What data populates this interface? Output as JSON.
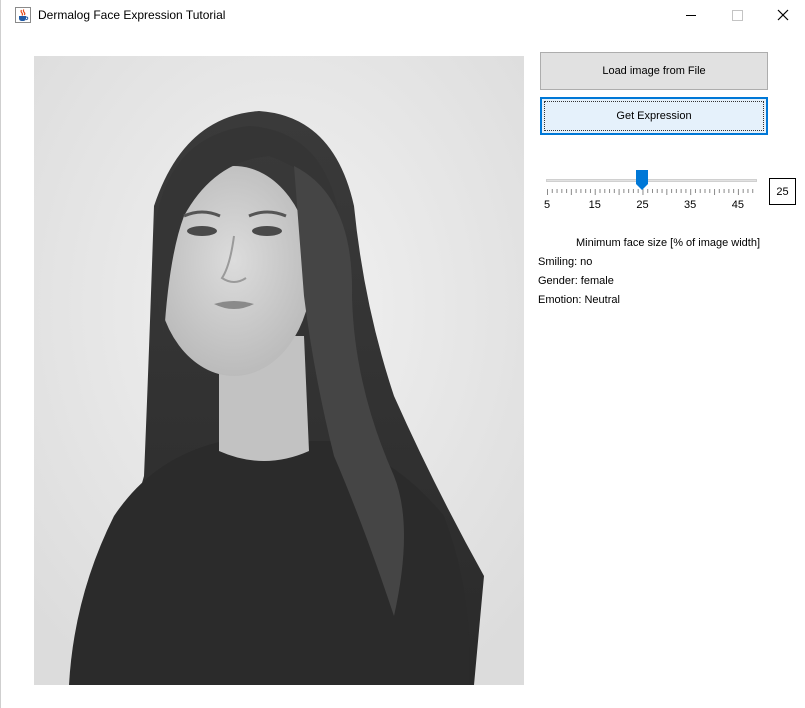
{
  "window": {
    "title": "Dermalog Face Expression Tutorial",
    "icon": "java-cup-icon",
    "controls": [
      "minimize-icon",
      "maximize-icon",
      "close-icon"
    ]
  },
  "buttons": {
    "load_label": "Load image from File",
    "get_label": "Get Expression"
  },
  "slider": {
    "min": 5,
    "max": 49,
    "value": 25,
    "tick_labels": [
      "5",
      "15",
      "25",
      "35",
      "45"
    ],
    "value_text": "25",
    "caption": "Minimum face size [% of image width]",
    "accent": "#0078d7"
  },
  "results": {
    "smiling": "Smiling: no",
    "gender": "Gender: female",
    "emotion": "Emotion: Neutral"
  }
}
